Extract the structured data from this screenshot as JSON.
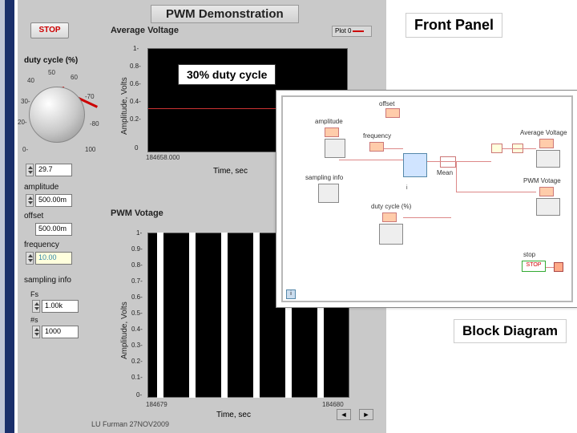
{
  "title": "PWM Demonstration",
  "labels": {
    "front_panel": "Front Panel",
    "block_diagram": "Block Diagram",
    "duty_callout": "30% duty cycle"
  },
  "stop_button": "STOP",
  "avg_chart": {
    "title": "Average Voltage",
    "legend": "Plot 0",
    "ylabel": "Amplitude, Volts",
    "xlabel": "Time, sec",
    "y_ticks": [
      "1-",
      "0.8-",
      "0.6-",
      "0.4-",
      "0.2-",
      "0"
    ],
    "x_tick": "184658.000"
  },
  "pwm_chart": {
    "title": "PWM Votage",
    "ylabel": "Amplitude, Volts",
    "xlabel": "Time, sec",
    "y_ticks": [
      "1-",
      "0.9-",
      "0.8-",
      "0.7-",
      "0.6-",
      "0.5-",
      "0.4-",
      "0.3-",
      "0.2-",
      "0.1-",
      "0-"
    ],
    "x_ticks": [
      "184679",
      "184680"
    ]
  },
  "controls": {
    "duty_label": "duty cycle (%)",
    "dial_ticks": {
      "t0": "0-",
      "t20": "20-",
      "t30": "30-",
      "t40": "40",
      "t50": "50",
      "t60": "60",
      "t70": "-70",
      "t80": "-80",
      "t100": "100"
    },
    "duty_value": "29.7",
    "amplitude_label": "amplitude",
    "amplitude_value": "500.00m",
    "offset_label": "offset",
    "offset_value": "500.00m",
    "frequency_label": "frequency",
    "frequency_value": "10.00",
    "sampling_label": "sampling info",
    "fs_label": "Fs",
    "fs_value": "1.00k",
    "ns_label": "#s",
    "ns_value": "1000"
  },
  "bd": {
    "offset": "offset",
    "amplitude": "amplitude",
    "frequency": "frequency",
    "sampling": "sampling info",
    "duty": "duty cycle (%)",
    "mean": "Mean",
    "avg_out": "Average Voltage",
    "pwm_out": "PWM Votage",
    "stop": "stop",
    "stop_btn": "STOP",
    "loop_i": "i"
  },
  "footer": {
    "left_arrow": "◄",
    "right_arrow": "►",
    "byline": "LU Furman 27NOV2009"
  },
  "chart_data": {
    "avg_voltage": {
      "type": "line",
      "ylabel": "Amplitude, Volts",
      "xlabel": "Time, sec",
      "ylim": [
        0,
        1
      ],
      "x": [
        184658.0
      ],
      "value_approx": 0.3,
      "title": "Average Voltage"
    },
    "pwm_voltage": {
      "type": "line",
      "ylabel": "Amplitude, Volts",
      "xlabel": "Time, sec",
      "ylim": [
        0,
        1
      ],
      "xlim": [
        184679,
        184680
      ],
      "duty_cycle_pct": 30,
      "amplitude": 1.0,
      "title": "PWM Votage"
    }
  }
}
